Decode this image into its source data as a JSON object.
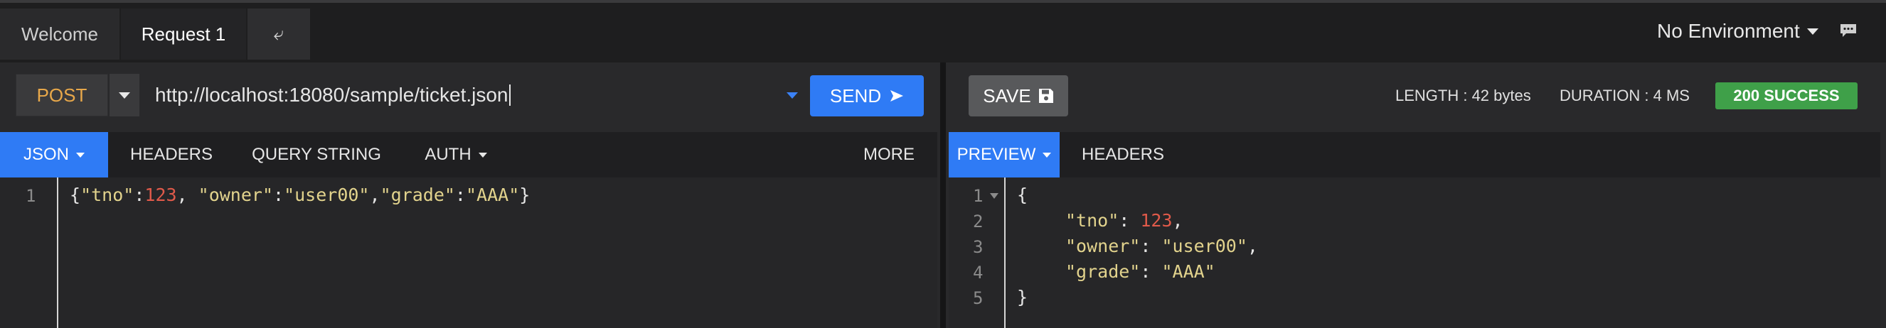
{
  "tabs": [
    {
      "label": "Welcome"
    },
    {
      "label": "Request 1"
    },
    {
      "label": "⤶"
    }
  ],
  "environment": {
    "label": "No Environment"
  },
  "request": {
    "method": "POST",
    "url": "http://localhost:18080/sample/ticket.json",
    "send_label": "SEND"
  },
  "request_tabs": [
    "JSON",
    "HEADERS",
    "QUERY STRING",
    "AUTH",
    "MORE"
  ],
  "request_body": {
    "line_numbers": [
      "1"
    ],
    "brace_open": "{",
    "k1": "\"tno\"",
    "colon1": ":",
    "v1": "123",
    "comma1": ", ",
    "k2": "\"owner\"",
    "colon2": ":",
    "v2": "\"user00\"",
    "comma2": ",",
    "k3": "\"grade\"",
    "colon3": ":",
    "v3": "\"AAA\"",
    "brace_close": "}"
  },
  "response": {
    "save_label": "SAVE",
    "length": "LENGTH : 42 bytes",
    "duration": "DURATION : 4 MS",
    "status": "200 SUCCESS"
  },
  "response_tabs": [
    "PREVIEW",
    "HEADERS"
  ],
  "response_body": {
    "line_numbers": [
      "1",
      "2",
      "3",
      "4",
      "5"
    ],
    "l1": "{",
    "l2_key": "\"tno\"",
    "l2_colon": ": ",
    "l2_val": "123",
    "l2_comma": ",",
    "l3_key": "\"owner\"",
    "l3_colon": ": ",
    "l3_val": "\"user00\"",
    "l3_comma": ",",
    "l4_key": "\"grade\"",
    "l4_colon": ": ",
    "l4_val": "\"AAA\"",
    "l5": "}"
  },
  "colors": {
    "accent": "#2f7bf5",
    "success": "#3fa049",
    "method": "#e8a84a",
    "string": "#e2d38d",
    "number": "#e05a4a"
  }
}
